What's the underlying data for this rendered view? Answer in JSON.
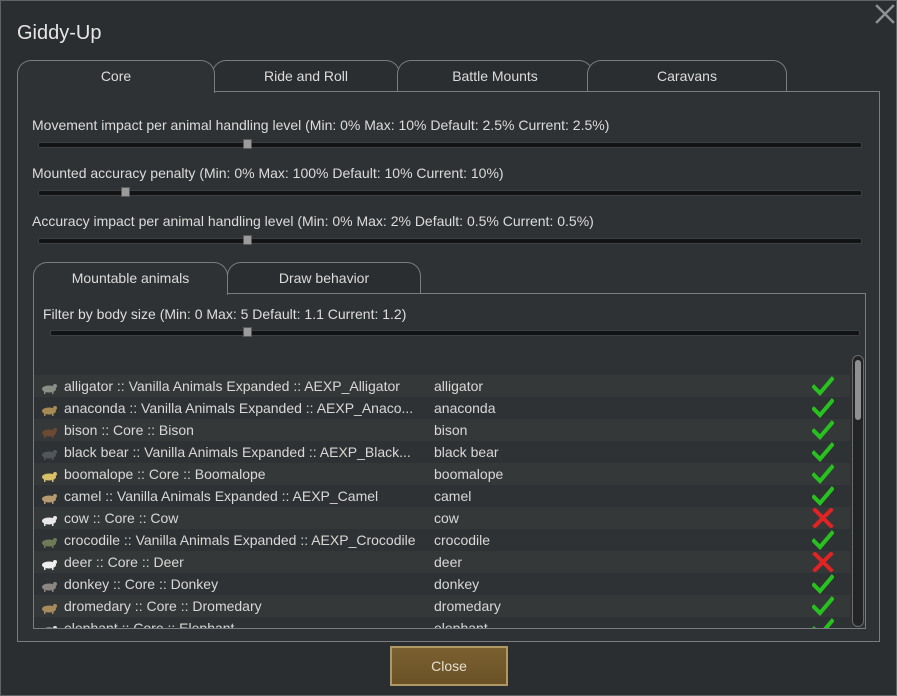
{
  "window": {
    "title": "Giddy-Up"
  },
  "tabs": [
    {
      "label": "Core",
      "active": true
    },
    {
      "label": "Ride and Roll",
      "active": false
    },
    {
      "label": "Battle Mounts",
      "active": false
    },
    {
      "label": "Caravans",
      "active": false
    }
  ],
  "settings": [
    {
      "label": "Movement impact per animal handling level (Min: 0% Max: 10% Default: 2.5% Current: 2.5%)",
      "fraction": 0.25
    },
    {
      "label": "Mounted accuracy penalty (Min: 0% Max: 100% Default: 10% Current: 10%)",
      "fraction": 0.1
    },
    {
      "label": "Accuracy impact per animal handling level (Min: 0% Max: 2% Default: 0.5% Current: 0.5%)",
      "fraction": 0.25
    }
  ],
  "subtabs": [
    {
      "label": "Mountable animals",
      "active": true
    },
    {
      "label": "Draw behavior",
      "active": false
    }
  ],
  "filter": {
    "label": "Filter by body size (Min: 0 Max: 5 Default: 1.1 Current: 1.2)",
    "fraction": 0.24
  },
  "animals": [
    {
      "name": "alligator :: Vanilla Animals Expanded :: AEXP_Alligator",
      "short": "alligator",
      "enabled": true,
      "icon": "alligator-icon",
      "icon_color": "#8a8f85"
    },
    {
      "name": "anaconda :: Vanilla Animals Expanded :: AEXP_Anaco...",
      "short": "anaconda",
      "enabled": true,
      "icon": "snake-icon",
      "icon_color": "#a58a55"
    },
    {
      "name": "bison :: Core :: Bison",
      "short": "bison",
      "enabled": true,
      "icon": "bison-icon",
      "icon_color": "#6e4a34"
    },
    {
      "name": "black bear :: Vanilla Animals Expanded :: AEXP_Black...",
      "short": "black bear",
      "enabled": true,
      "icon": "bear-icon",
      "icon_color": "#50565c"
    },
    {
      "name": "boomalope :: Core :: Boomalope",
      "short": "boomalope",
      "enabled": true,
      "icon": "boomalope-icon",
      "icon_color": "#d8c068"
    },
    {
      "name": "camel :: Vanilla Animals Expanded :: AEXP_Camel",
      "short": "camel",
      "enabled": true,
      "icon": "camel-icon",
      "icon_color": "#b49a6e"
    },
    {
      "name": "cow :: Core :: Cow",
      "short": "cow",
      "enabled": false,
      "icon": "cow-icon",
      "icon_color": "#e8e8e8"
    },
    {
      "name": "crocodile :: Vanilla Animals Expanded :: AEXP_Crocodile",
      "short": "crocodile",
      "enabled": true,
      "icon": "crocodile-icon",
      "icon_color": "#6f7a58"
    },
    {
      "name": "deer :: Core :: Deer",
      "short": "deer",
      "enabled": false,
      "icon": "deer-icon",
      "icon_color": "#eeeeee"
    },
    {
      "name": "donkey :: Core :: Donkey",
      "short": "donkey",
      "enabled": true,
      "icon": "donkey-icon",
      "icon_color": "#8c8682"
    },
    {
      "name": "dromedary :: Core :: Dromedary",
      "short": "dromedary",
      "enabled": true,
      "icon": "dromedary-icon",
      "icon_color": "#a88a5c"
    },
    {
      "name": "elephant :: Core :: Elephant",
      "short": "elephant",
      "enabled": true,
      "icon": "elephant-icon",
      "icon_color": "#e0e0e0"
    }
  ],
  "colors": {
    "check": "#27c21f",
    "cross": "#e02424",
    "accent": "#7a6030"
  },
  "footer": {
    "close_label": "Close"
  }
}
